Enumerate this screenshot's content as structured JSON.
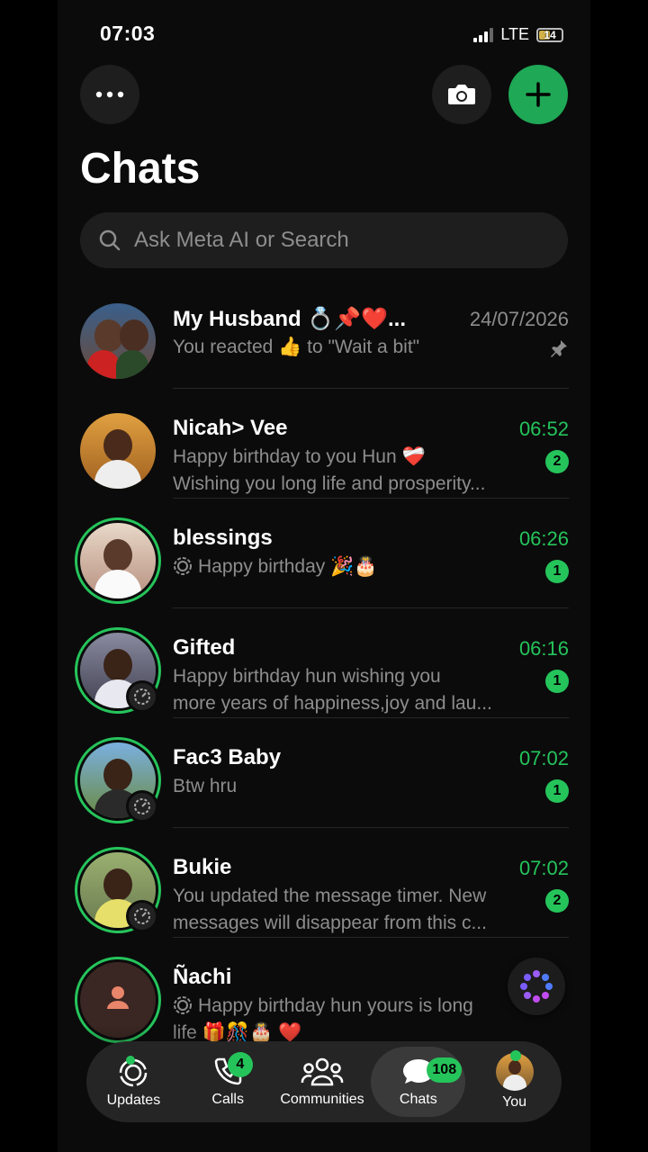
{
  "status_bar": {
    "time": "07:03",
    "network": "LTE",
    "battery": "14"
  },
  "header": {
    "title": "Chats"
  },
  "search": {
    "placeholder": "Ask Meta AI or Search"
  },
  "chats": [
    {
      "name": "My Husband 💍📌❤️...",
      "time": "24/07/2026",
      "preview": [
        "You reacted 👍 to \"Wait a bit\""
      ],
      "pinned": true,
      "unread": ""
    },
    {
      "name": "Nicah> Vee",
      "time": "06:52",
      "preview": [
        "Happy birthday to you Hun ❤️‍🩹",
        "Wishing you long life and prosperity..."
      ],
      "unread": "2"
    },
    {
      "name": "blessings",
      "time": "06:26",
      "preview": [
        "Happy birthday 🎉🎂"
      ],
      "unread": "1",
      "status_icon": "status-icon"
    },
    {
      "name": "Gifted",
      "time": "06:16",
      "preview": [
        "Happy birthday hun wishing you",
        "more years of happiness,joy and lau..."
      ],
      "unread": "1"
    },
    {
      "name": "Fac3 Baby",
      "time": "07:02",
      "preview": [
        "Btw hru"
      ],
      "unread": "1"
    },
    {
      "name": "Bukie",
      "time": "07:02",
      "preview": [
        "You updated the message timer. New",
        "messages will disappear from this c..."
      ],
      "unread": "2"
    },
    {
      "name": "Ñachi",
      "time": "",
      "preview": [
        "Happy birthday hun yours is long",
        "life 🎁🎊🎂 ❤️"
      ],
      "unread": "",
      "status_icon": "status-icon"
    }
  ],
  "tabs": [
    {
      "label": "Updates",
      "icon": "updates-icon"
    },
    {
      "label": "Calls",
      "icon": "phone-icon",
      "badge": "4"
    },
    {
      "label": "Communities",
      "icon": "communities-icon"
    },
    {
      "label": "Chats",
      "icon": "chats-icon",
      "badge": "108",
      "active": true
    },
    {
      "label": "You",
      "icon": "avatar"
    }
  ],
  "colors": {
    "accent": "#25c45b",
    "background": "#0b0b0b",
    "surface": "#1e1e1e",
    "muted_text": "#8d8d8d"
  }
}
